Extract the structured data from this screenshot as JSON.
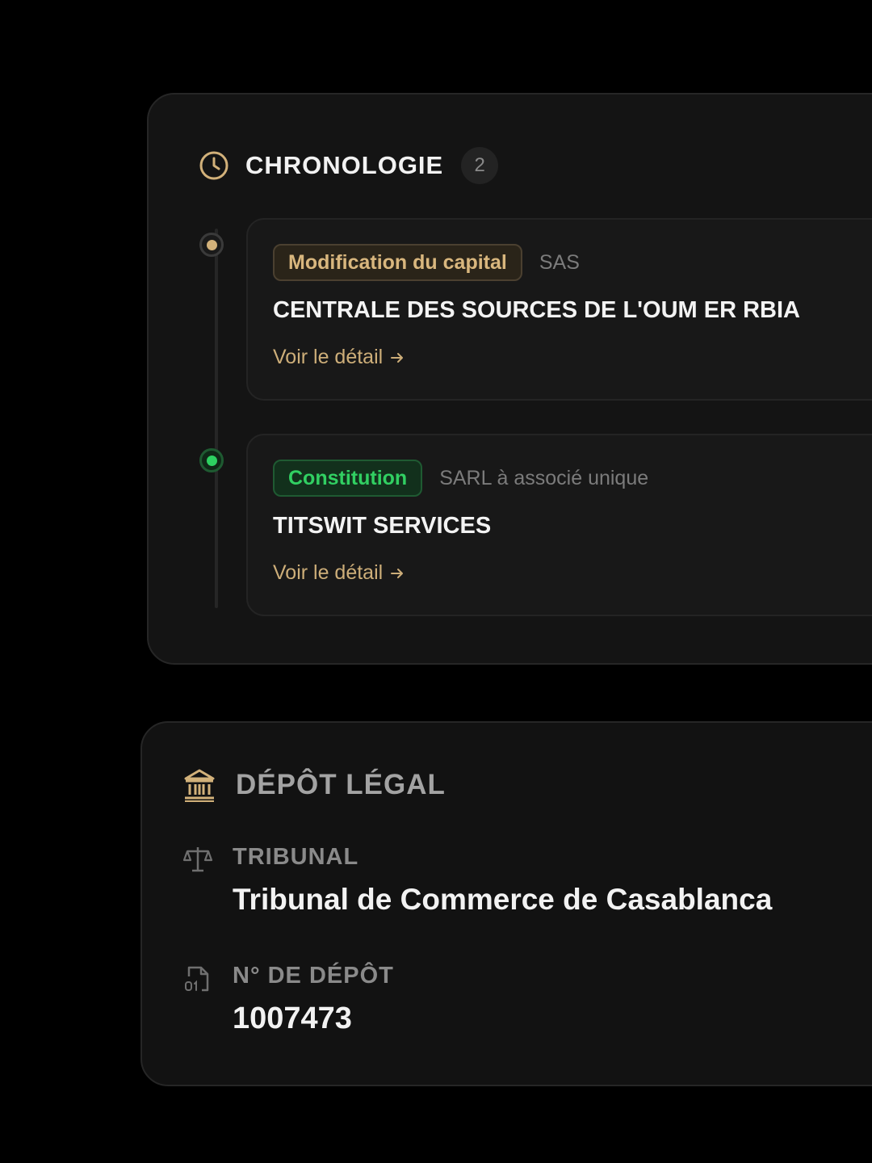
{
  "chronologie": {
    "title": "CHRONOLOGIE",
    "count": "2",
    "icon": "clock-icon",
    "events": [
      {
        "tag": "Modification du capital",
        "tag_color": "#d9b77e",
        "legal_form": "SAS",
        "company": "CENTRALE DES SOURCES DE L'OUM ER RBIA",
        "link": "Voir le détail"
      },
      {
        "tag": "Constitution",
        "tag_color": "#31cf62",
        "legal_form": "SARL à associé unique",
        "company": "TITSWIT SERVICES",
        "link": "Voir le détail"
      }
    ]
  },
  "depot_legal": {
    "title": "DÉPÔT LÉGAL",
    "icon": "bank-icon",
    "tribunal": {
      "label": "TRIBUNAL",
      "value": "Tribunal de Commerce de Casablanca",
      "icon": "scale-icon"
    },
    "depot_number": {
      "label": "N° DE DÉPÔT",
      "value": "1007473",
      "icon": "file-binary-icon"
    }
  },
  "colors": {
    "accent_gold": "#d2b17a",
    "accent_green": "#2dd061",
    "background": "#000000",
    "card": "#141414"
  }
}
